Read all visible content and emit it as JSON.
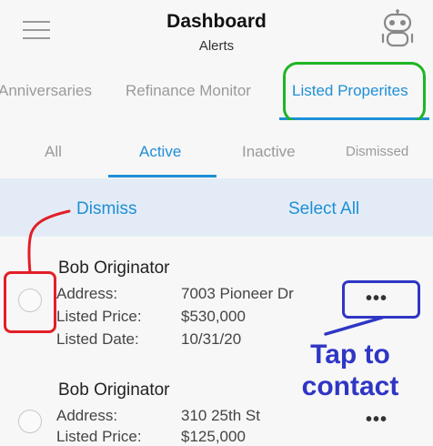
{
  "header": {
    "title": "Dashboard",
    "subtitle": "Alerts"
  },
  "tabs": [
    {
      "label": "Anniversaries"
    },
    {
      "label": "Refinance Monitor"
    },
    {
      "label": "Listed Properites"
    }
  ],
  "subtabs": [
    {
      "label": "All"
    },
    {
      "label": "Active"
    },
    {
      "label": "Inactive"
    },
    {
      "label": "Dismissed"
    }
  ],
  "actions": {
    "dismiss": "Dismiss",
    "select_all": "Select All"
  },
  "listings": [
    {
      "name": "Bob Originator",
      "address_label": "Address:",
      "address": "7003 Pioneer Dr",
      "price_label": "Listed Price:",
      "price": "$530,000",
      "date_label": "Listed Date:",
      "date": "10/31/20",
      "more": "•••"
    },
    {
      "name": "Bob Originator",
      "address_label": "Address:",
      "address": "310 25th St",
      "price_label": "Listed Price:",
      "price": "$125,000",
      "more": "•••"
    }
  ],
  "annotation": {
    "text": "Tap to contact"
  },
  "colors": {
    "accent": "#1f8fd6",
    "annotation_green": "#1fb524",
    "annotation_red": "#e21f27",
    "annotation_blue": "#2f36c4"
  }
}
